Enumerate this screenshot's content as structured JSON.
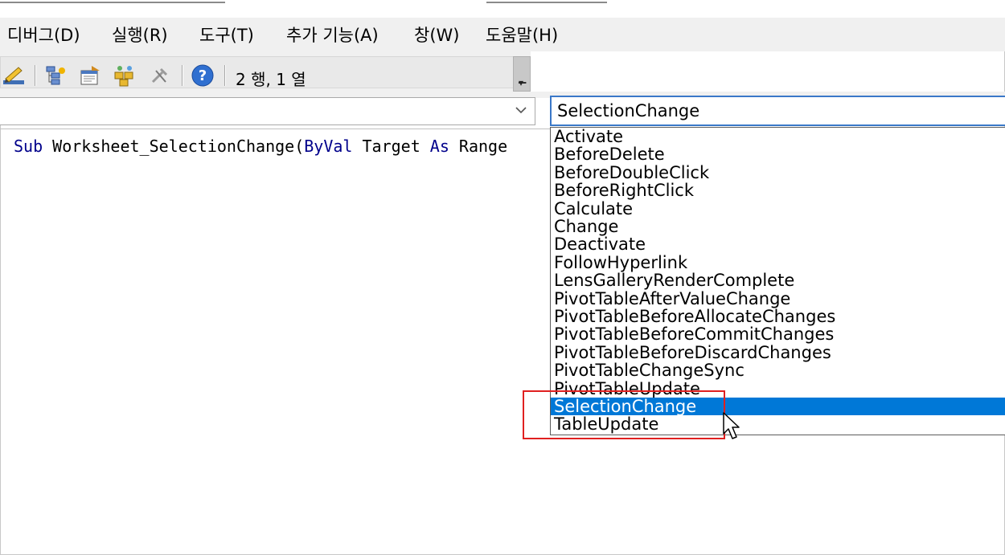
{
  "menu": {
    "items": [
      {
        "label": "디버그(D)"
      },
      {
        "label": "실행(R)"
      },
      {
        "label": "도구(T)"
      },
      {
        "label": "추가 기능(A)"
      },
      {
        "label": "창(W)"
      },
      {
        "label": "도움말(H)"
      }
    ]
  },
  "toolbar": {
    "cursor_position": "2 행, 1 열",
    "icons": [
      "design-mode-icon",
      "project-explorer-icon",
      "properties-window-icon",
      "object-browser-icon",
      "toolbox-icon",
      "help-icon"
    ]
  },
  "object_combo": {
    "value": ""
  },
  "procedure_combo": {
    "value": "SelectionChange",
    "options": [
      "Activate",
      "BeforeDelete",
      "BeforeDoubleClick",
      "BeforeRightClick",
      "Calculate",
      "Change",
      "Deactivate",
      "FollowHyperlink",
      "LensGalleryRenderComplete",
      "PivotTableAfterValueChange",
      "PivotTableBeforeAllocateChanges",
      "PivotTableBeforeCommitChanges",
      "PivotTableBeforeDiscardChanges",
      "PivotTableChangeSync",
      "PivotTableUpdate",
      "SelectionChange",
      "TableUpdate"
    ],
    "selected_index": 15
  },
  "code": {
    "kw_sub": "Sub",
    "name": " Worksheet_SelectionChange(",
    "kw_byval": "ByVal",
    "param": " Target ",
    "kw_as": "As",
    "type": " Range"
  },
  "colors": {
    "selection": "#0078d7",
    "keyword": "#00008b",
    "annotation": "#e02020"
  }
}
